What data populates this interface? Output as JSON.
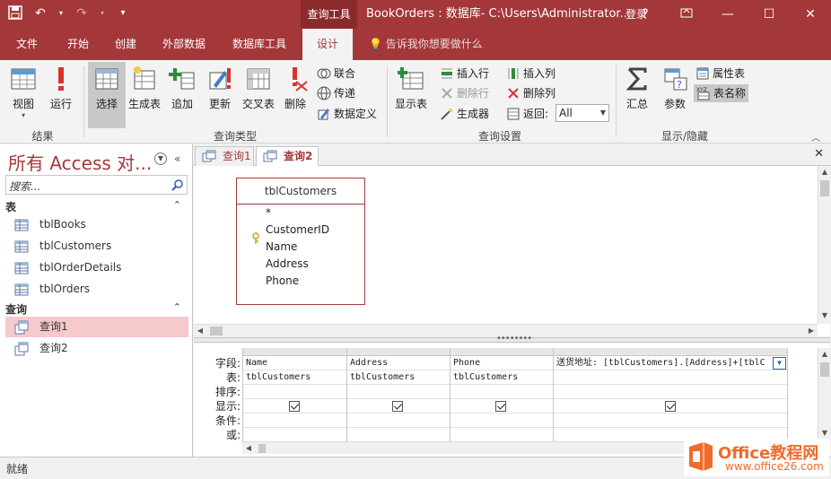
{
  "titlebar": {
    "context_tools": "查询工具",
    "title": "BookOrders : 数据库- C:\\Users\\Administrator...",
    "login": "登录",
    "help": "?"
  },
  "tabs": [
    {
      "label": "文件"
    },
    {
      "label": "开始"
    },
    {
      "label": "创建"
    },
    {
      "label": "外部数据"
    },
    {
      "label": "数据库工具"
    },
    {
      "label": "设计"
    }
  ],
  "tellme": "告诉我你想要做什么",
  "ribbon": {
    "results": {
      "view": "视图",
      "run": "运行",
      "group": "结果"
    },
    "query_type": {
      "select": "选择",
      "make_table": "生成表",
      "append": "追加",
      "update": "更新",
      "crosstab": "交叉表",
      "delete": "删除",
      "union": "联合",
      "passthrough": "传递",
      "data_definition": "数据定义",
      "group": "查询类型"
    },
    "query_setup": {
      "show_table": "显示表",
      "insert_row": "插入行",
      "delete_row": "删除行",
      "builder": "生成器",
      "insert_column": "插入列",
      "delete_column": "删除列",
      "return_label": "返回:",
      "return_value": "All",
      "group": "查询设置"
    },
    "show_hide": {
      "totals": "汇总",
      "parameters": "参数",
      "property_sheet": "属性表",
      "table_names": "表名称",
      "group": "显示/隐藏"
    }
  },
  "nav": {
    "title": "所有 Access 对...",
    "search_placeholder": "搜索...",
    "sections": [
      {
        "label": "表",
        "items": [
          "tblBooks",
          "tblCustomers",
          "tblOrderDetails",
          "tblOrders"
        ]
      },
      {
        "label": "查询",
        "items": [
          "查询1",
          "查询2"
        ]
      }
    ]
  },
  "doctabs": [
    {
      "label": "查询1"
    },
    {
      "label": "查询2"
    }
  ],
  "design": {
    "table_name": "tblCustomers",
    "fields": [
      "*",
      "CustomerID",
      "Name",
      "Address",
      "Phone"
    ]
  },
  "grid": {
    "row_labels": [
      "字段:",
      "表:",
      "排序:",
      "显示:",
      "条件:",
      "或:"
    ],
    "columns": [
      {
        "field": "Name",
        "table": "tblCustomers",
        "show": true
      },
      {
        "field": "Address",
        "table": "tblCustomers",
        "show": true
      },
      {
        "field": "Phone",
        "table": "tblCustomers",
        "show": true
      },
      {
        "field": "送货地址: [tblCustomers].[Address]+[tblC",
        "table": "",
        "show": true
      }
    ]
  },
  "status": "就绪",
  "watermark": {
    "line1": "Office教程网",
    "line2": "www.office26.com"
  },
  "colors": {
    "brand": "#a4373a",
    "selected_nav": "#f6c9cb"
  }
}
